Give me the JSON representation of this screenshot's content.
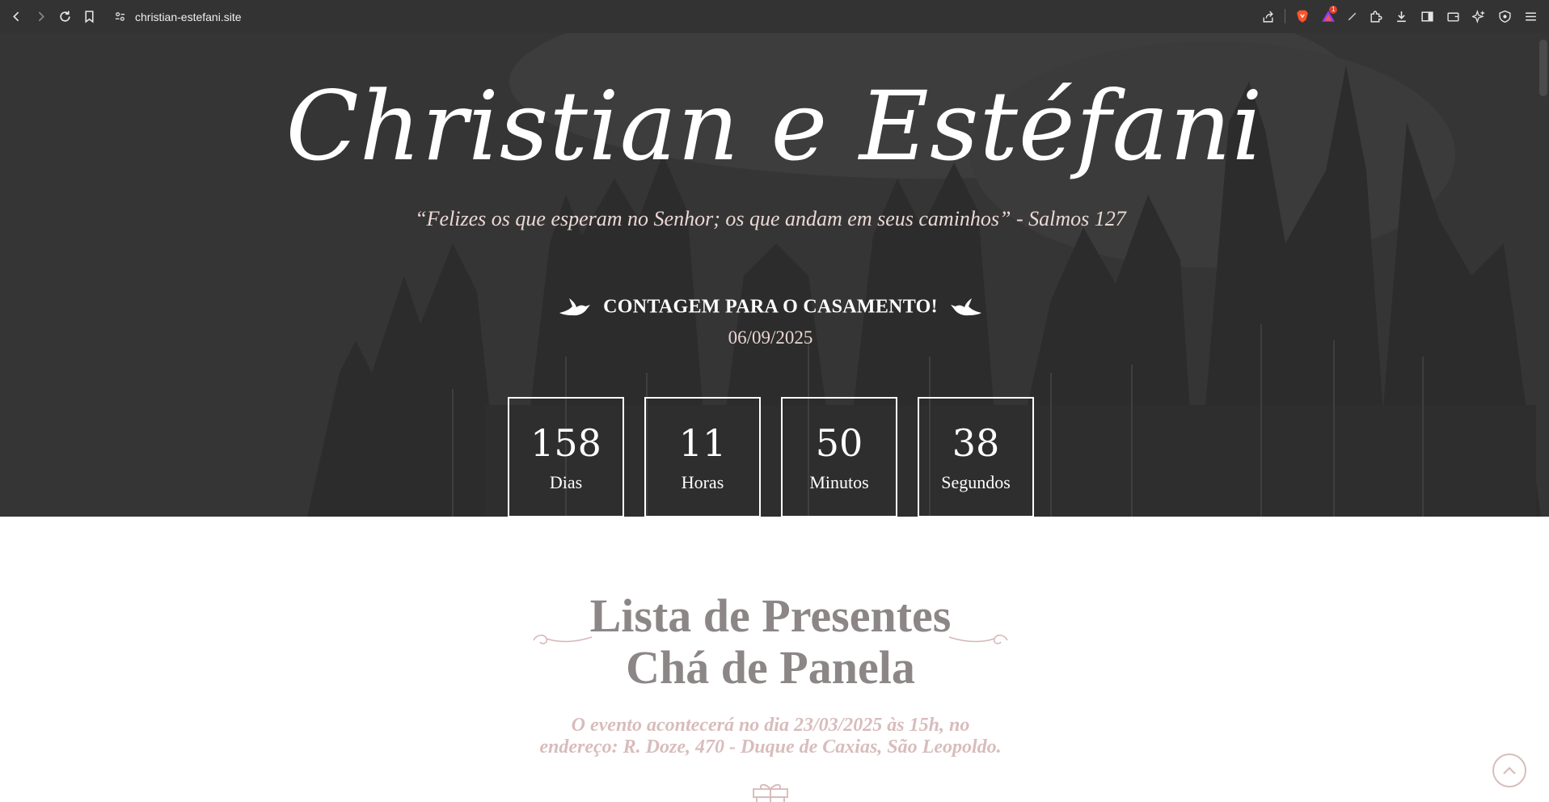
{
  "browser": {
    "url": "christian-estefani.site",
    "rewards_badge": "1",
    "icons": [
      "back-icon",
      "forward-icon",
      "reload-icon",
      "bookmark-icon",
      "site-settings-icon",
      "share-icon",
      "brave-shields-icon",
      "brave-rewards-icon",
      "extensions-icon",
      "downloads-icon",
      "sidebar-icon",
      "wallet-icon",
      "leo-icon",
      "vpn-icon",
      "menu-icon"
    ]
  },
  "hero": {
    "title": "Christian e Estéfani",
    "quote": "“Felizes os que esperam no Senhor; os que andam em seus caminhos” - Salmos 127",
    "countdown_title": "CONTAGEM PARA O CASAMENTO!",
    "date": "06/09/2025",
    "countdown": [
      {
        "value": "158",
        "label": "Dias"
      },
      {
        "value": "11",
        "label": "Horas"
      },
      {
        "value": "50",
        "label": "Minutos"
      },
      {
        "value": "38",
        "label": "Segundos"
      }
    ]
  },
  "gifts": {
    "title_line1": "Lista de Presentes",
    "title_line2": "Chá de Panela",
    "event_line1": "O evento acontecerá no dia 23/03/2025 às 15h, no",
    "event_line2": "endereço: R. Doze, 470 - Duque de Caxias, São Leopoldo."
  },
  "colors": {
    "hero_bg": "#353535",
    "title_gray": "#8c8686",
    "accent_pink": "#d9bcbc",
    "quote_pink": "#ecd8d6"
  }
}
